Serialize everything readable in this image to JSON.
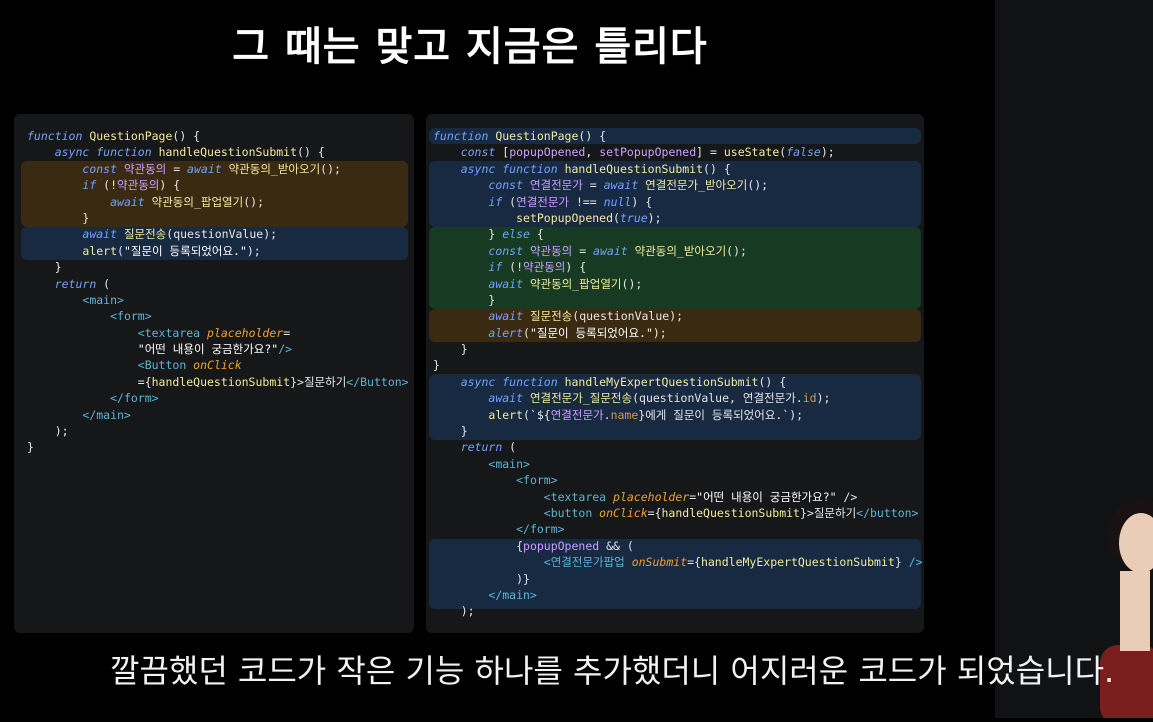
{
  "slide": {
    "title": "그 때는 맞고 지금은 틀리다",
    "subtitle": "깔끔했던 코드가 작은 기능 하나를 추가했더니 어지러운 코드가 되었습니다."
  },
  "left_code": [
    [
      [
        "kw",
        "function "
      ],
      [
        "fn",
        "QuestionPage"
      ],
      [
        "pl",
        "() {"
      ]
    ],
    [
      [
        "pl",
        "    "
      ],
      [
        "kw",
        "async function "
      ],
      [
        "fn",
        "handleQuestionSubmit"
      ],
      [
        "pl",
        "() {"
      ]
    ],
    [
      [
        "pl",
        "        "
      ],
      [
        "kw",
        "const "
      ],
      [
        "var",
        "약관동의"
      ],
      [
        "pl",
        " = "
      ],
      [
        "kw",
        "await "
      ],
      [
        "fn",
        "약관동의_받아오기"
      ],
      [
        "pl",
        "();"
      ]
    ],
    [
      [
        "pl",
        "        "
      ],
      [
        "kw",
        "if "
      ],
      [
        "pl",
        "(!"
      ],
      [
        "var",
        "약관동의"
      ],
      [
        "pl",
        ") {"
      ]
    ],
    [
      [
        "pl",
        "            "
      ],
      [
        "kw",
        "await "
      ],
      [
        "fn",
        "약관동의_팝업열기"
      ],
      [
        "pl",
        "();"
      ]
    ],
    [
      [
        "pl",
        "        }"
      ]
    ],
    [
      [
        "pl",
        "        "
      ],
      [
        "kw",
        "await "
      ],
      [
        "fn",
        "질문전송"
      ],
      [
        "pl",
        "(questionValue);"
      ]
    ],
    [
      [
        "pl",
        "        "
      ],
      [
        "fn",
        "alert"
      ],
      [
        "pl",
        "("
      ],
      [
        "str",
        "\"질문이 등록되었어요.\""
      ],
      [
        "pl",
        ");"
      ]
    ],
    [
      [
        "pl",
        "    }"
      ]
    ],
    [
      [
        "pl",
        "    "
      ],
      [
        "kw",
        "return "
      ],
      [
        "pl",
        "("
      ]
    ],
    [
      [
        "pl",
        "        "
      ],
      [
        "tag",
        "<main>"
      ]
    ],
    [
      [
        "pl",
        "            "
      ],
      [
        "tag",
        "<form>"
      ]
    ],
    [
      [
        "pl",
        "                "
      ],
      [
        "tag",
        "<textarea "
      ],
      [
        "attr",
        "placeholder"
      ],
      [
        "pl",
        "="
      ]
    ],
    [
      [
        "pl",
        "                "
      ],
      [
        "str",
        "\"어떤 내용이 궁금한가요?\""
      ],
      [
        "tag",
        "/>"
      ]
    ],
    [
      [
        "pl",
        "                "
      ],
      [
        "tag",
        "<Button "
      ],
      [
        "attr",
        "onClick"
      ]
    ],
    [
      [
        "pl",
        "                ={"
      ],
      [
        "fn",
        "handleQuestionSubmit"
      ],
      [
        "pl",
        "}>질문하기"
      ],
      [
        "tag",
        "</Button>"
      ]
    ],
    [
      [
        "pl",
        "            "
      ],
      [
        "tag",
        "</form>"
      ]
    ],
    [
      [
        "pl",
        "        "
      ],
      [
        "tag",
        "</main>"
      ]
    ],
    [
      [
        "pl",
        "    );"
      ]
    ],
    [
      [
        "pl",
        "}"
      ]
    ]
  ],
  "right_code": [
    [
      [
        "kw",
        "function "
      ],
      [
        "fn",
        "QuestionPage"
      ],
      [
        "pl",
        "() {"
      ]
    ],
    [
      [
        "pl",
        "    "
      ],
      [
        "kw",
        "const "
      ],
      [
        "pl",
        "["
      ],
      [
        "var",
        "popupOpened"
      ],
      [
        "pl",
        ", "
      ],
      [
        "var",
        "setPopupOpened"
      ],
      [
        "pl",
        "] = "
      ],
      [
        "fn",
        "useState"
      ],
      [
        "pl",
        "("
      ],
      [
        "kw",
        "false"
      ],
      [
        "pl",
        ");"
      ]
    ],
    [
      [
        "pl",
        "    "
      ],
      [
        "kw",
        "async function "
      ],
      [
        "fn",
        "handleQuestionSubmit"
      ],
      [
        "pl",
        "() {"
      ]
    ],
    [
      [
        "pl",
        "        "
      ],
      [
        "kw",
        "const "
      ],
      [
        "var",
        "연결전문가"
      ],
      [
        "pl",
        " = "
      ],
      [
        "kw",
        "await "
      ],
      [
        "fn",
        "연결전문가_받아오기"
      ],
      [
        "pl",
        "();"
      ]
    ],
    [
      [
        "pl",
        "        "
      ],
      [
        "kw",
        "if "
      ],
      [
        "pl",
        "("
      ],
      [
        "var",
        "연결전문가"
      ],
      [
        "pl",
        " !== "
      ],
      [
        "kw",
        "null"
      ],
      [
        "pl",
        ") {"
      ]
    ],
    [
      [
        "pl",
        "            "
      ],
      [
        "fn",
        "setPopupOpened"
      ],
      [
        "pl",
        "("
      ],
      [
        "kw",
        "true"
      ],
      [
        "pl",
        ");"
      ]
    ],
    [
      [
        "pl",
        "        } "
      ],
      [
        "kw",
        "else "
      ],
      [
        "pl",
        "{"
      ]
    ],
    [
      [
        "pl",
        "        "
      ],
      [
        "kw",
        "const "
      ],
      [
        "var",
        "약관동의"
      ],
      [
        "pl",
        " = "
      ],
      [
        "kw",
        "await "
      ],
      [
        "fn",
        "약관동의_받아오기"
      ],
      [
        "pl",
        "();"
      ]
    ],
    [
      [
        "pl",
        "        "
      ],
      [
        "kw",
        "if "
      ],
      [
        "pl",
        "(!"
      ],
      [
        "var",
        "약관동의"
      ],
      [
        "pl",
        ") {"
      ]
    ],
    [
      [
        "pl",
        "        "
      ],
      [
        "kw",
        "await "
      ],
      [
        "fn",
        "약관동의_팝업열기"
      ],
      [
        "pl",
        "();"
      ]
    ],
    [
      [
        "pl",
        "        }"
      ]
    ],
    [
      [
        "pl",
        "        "
      ],
      [
        "kw",
        "await "
      ],
      [
        "fn",
        "질문전송"
      ],
      [
        "pl",
        "(questionValue);"
      ]
    ],
    [
      [
        "pl",
        "        "
      ],
      [
        "kw",
        "alert"
      ],
      [
        "pl",
        "("
      ],
      [
        "str",
        "\"질문이 등록되었어요.\""
      ],
      [
        "pl",
        ");"
      ]
    ],
    [
      [
        "pl",
        "    }"
      ]
    ],
    [
      [
        "pl",
        "}"
      ]
    ],
    [
      [
        "pl",
        "    "
      ],
      [
        "kw",
        "async function "
      ],
      [
        "fn",
        "handleMyExpertQuestionSubmit"
      ],
      [
        "pl",
        "() {"
      ]
    ],
    [
      [
        "pl",
        "        "
      ],
      [
        "kw",
        "await "
      ],
      [
        "fn",
        "연결전문가_질문전송"
      ],
      [
        "pl",
        "(questionValue, 연결전문가."
      ],
      [
        "prop",
        "id"
      ],
      [
        "pl",
        ");"
      ]
    ],
    [
      [
        "pl",
        "        "
      ],
      [
        "fn",
        "alert"
      ],
      [
        "pl",
        "(`${"
      ],
      [
        "var",
        "연결전문가"
      ],
      [
        "pl",
        "."
      ],
      [
        "prop",
        "name"
      ],
      [
        "pl",
        "}에게 질문이 등록되었어요.`);"
      ]
    ],
    [
      [
        "pl",
        "    }"
      ]
    ],
    [
      [
        "pl",
        "    "
      ],
      [
        "kw",
        "return "
      ],
      [
        "pl",
        "("
      ]
    ],
    [
      [
        "pl",
        "        "
      ],
      [
        "tag",
        "<main>"
      ]
    ],
    [
      [
        "pl",
        "            "
      ],
      [
        "tag",
        "<form>"
      ]
    ],
    [
      [
        "pl",
        "                "
      ],
      [
        "tag",
        "<textarea "
      ],
      [
        "attr",
        "placeholder"
      ],
      [
        "pl",
        "="
      ],
      [
        "str",
        "\"어떤 내용이 궁금한가요?\""
      ],
      [
        "pl",
        " />"
      ]
    ],
    [
      [
        "pl",
        "                "
      ],
      [
        "tag",
        "<button "
      ],
      [
        "attr",
        "onClick"
      ],
      [
        "pl",
        "={"
      ],
      [
        "fn",
        "handleQuestionSubmit"
      ],
      [
        "pl",
        "}>질문하기"
      ],
      [
        "tag",
        "</button>"
      ]
    ],
    [
      [
        "pl",
        "            "
      ],
      [
        "tag",
        "</form>"
      ]
    ],
    [
      [
        "pl",
        "            {"
      ],
      [
        "var",
        "popupOpened"
      ],
      [
        "pl",
        " && ("
      ]
    ],
    [
      [
        "pl",
        "                "
      ],
      [
        "tag",
        "<연결전문가팝업 "
      ],
      [
        "attr",
        "onSubmit"
      ],
      [
        "pl",
        "={"
      ],
      [
        "fn",
        "handleMyExpertQuestionSubmit"
      ],
      [
        "pl",
        "} "
      ],
      [
        "tag",
        "/>"
      ]
    ],
    [
      [
        "pl",
        "            )}"
      ]
    ],
    [
      [
        "pl",
        "        "
      ],
      [
        "tag",
        "</main>"
      ]
    ],
    [
      [
        "pl",
        "    );"
      ]
    ]
  ],
  "colors": {
    "keyword": "#6fa3ff",
    "function": "#f2ea9c",
    "tag": "#5fb3d6",
    "attribute": "#f0a030",
    "highlight_orange": "#3a2a12",
    "highlight_blue": "#172a42",
    "highlight_green": "#163a22"
  },
  "icons": {
    "presenter": "person-video-icon"
  }
}
